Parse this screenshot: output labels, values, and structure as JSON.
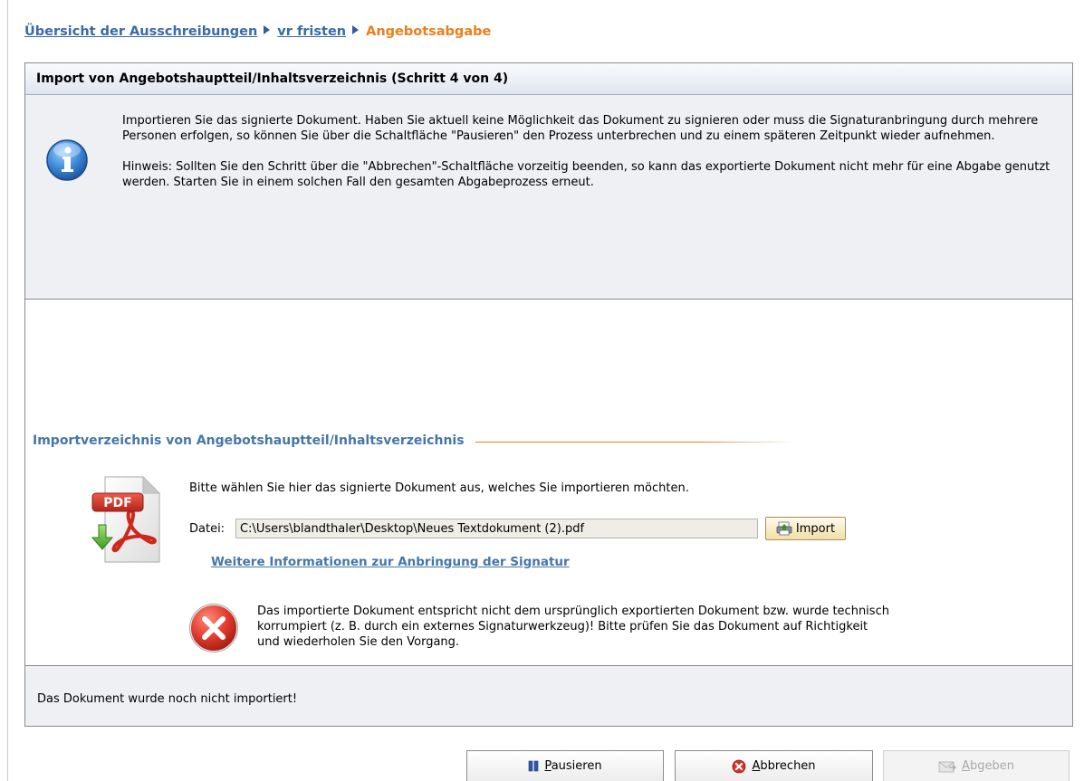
{
  "breadcrumb": {
    "items": [
      "Übersicht der Ausschreibungen",
      "vr fristen"
    ],
    "current": "Angebotsabgabe"
  },
  "wizard": {
    "title": "Import von Angebotshauptteil/Inhaltsverzeichnis (Schritt 4 von 4)",
    "info": {
      "paragraph1": "Importieren Sie das signierte Dokument. Haben Sie aktuell keine Möglichkeit das Dokument zu signieren oder muss die Signaturanbringung durch mehrere Personen erfolgen, so können Sie über die Schaltfläche \"Pausieren\" den Prozess unterbrechen und zu einem späteren Zeitpunkt wieder aufnehmen.",
      "paragraph2": "Hinweis: Sollten Sie den Schritt über die \"Abbrechen\"-Schaltfläche vorzeitig beenden, so kann das exportierte Dokument nicht mehr für eine Abgabe genutzt werden. Starten Sie in einem solchen Fall den gesamten Abgabeprozess erneut."
    },
    "import_section": {
      "title": "Importverzeichnis von Angebotshauptteil/Inhaltsverzeichnis",
      "instruction": "Bitte wählen Sie hier das signierte Dokument aus, welches Sie importieren möchten.",
      "file_label": "Datei:",
      "file_value": "C:\\Users\\blandthaler\\Desktop\\Neues Textdokument (2).pdf",
      "import_button": "Import",
      "pdf_badge": "PDF",
      "link": "Weitere Informationen zur Anbringung der Signatur",
      "error_message": "Das importierte Dokument entspricht nicht dem ursprünglich exportierten Dokument bzw. wurde technisch korrumpiert (z. B. durch ein externes Signaturwerkzeug)! Bitte prüfen Sie das Dokument auf Richtigkeit und wiederholen Sie den Vorgang."
    },
    "status": "Das Dokument wurde noch nicht importiert!"
  },
  "footer": {
    "pause": "Pausieren",
    "cancel": "Abbrechen",
    "submit": "Abgeben"
  },
  "colors": {
    "link_blue": "#3a6aa8",
    "accent_orange": "#ef7d1a",
    "info_bg": "#eef0f4",
    "error_red": "#d9322b"
  },
  "icons": [
    "arrow-right-icon",
    "info-icon",
    "pdf-file-icon",
    "printer-import-icon",
    "error-icon",
    "pause-icon",
    "cancel-icon",
    "submit-icon"
  ]
}
